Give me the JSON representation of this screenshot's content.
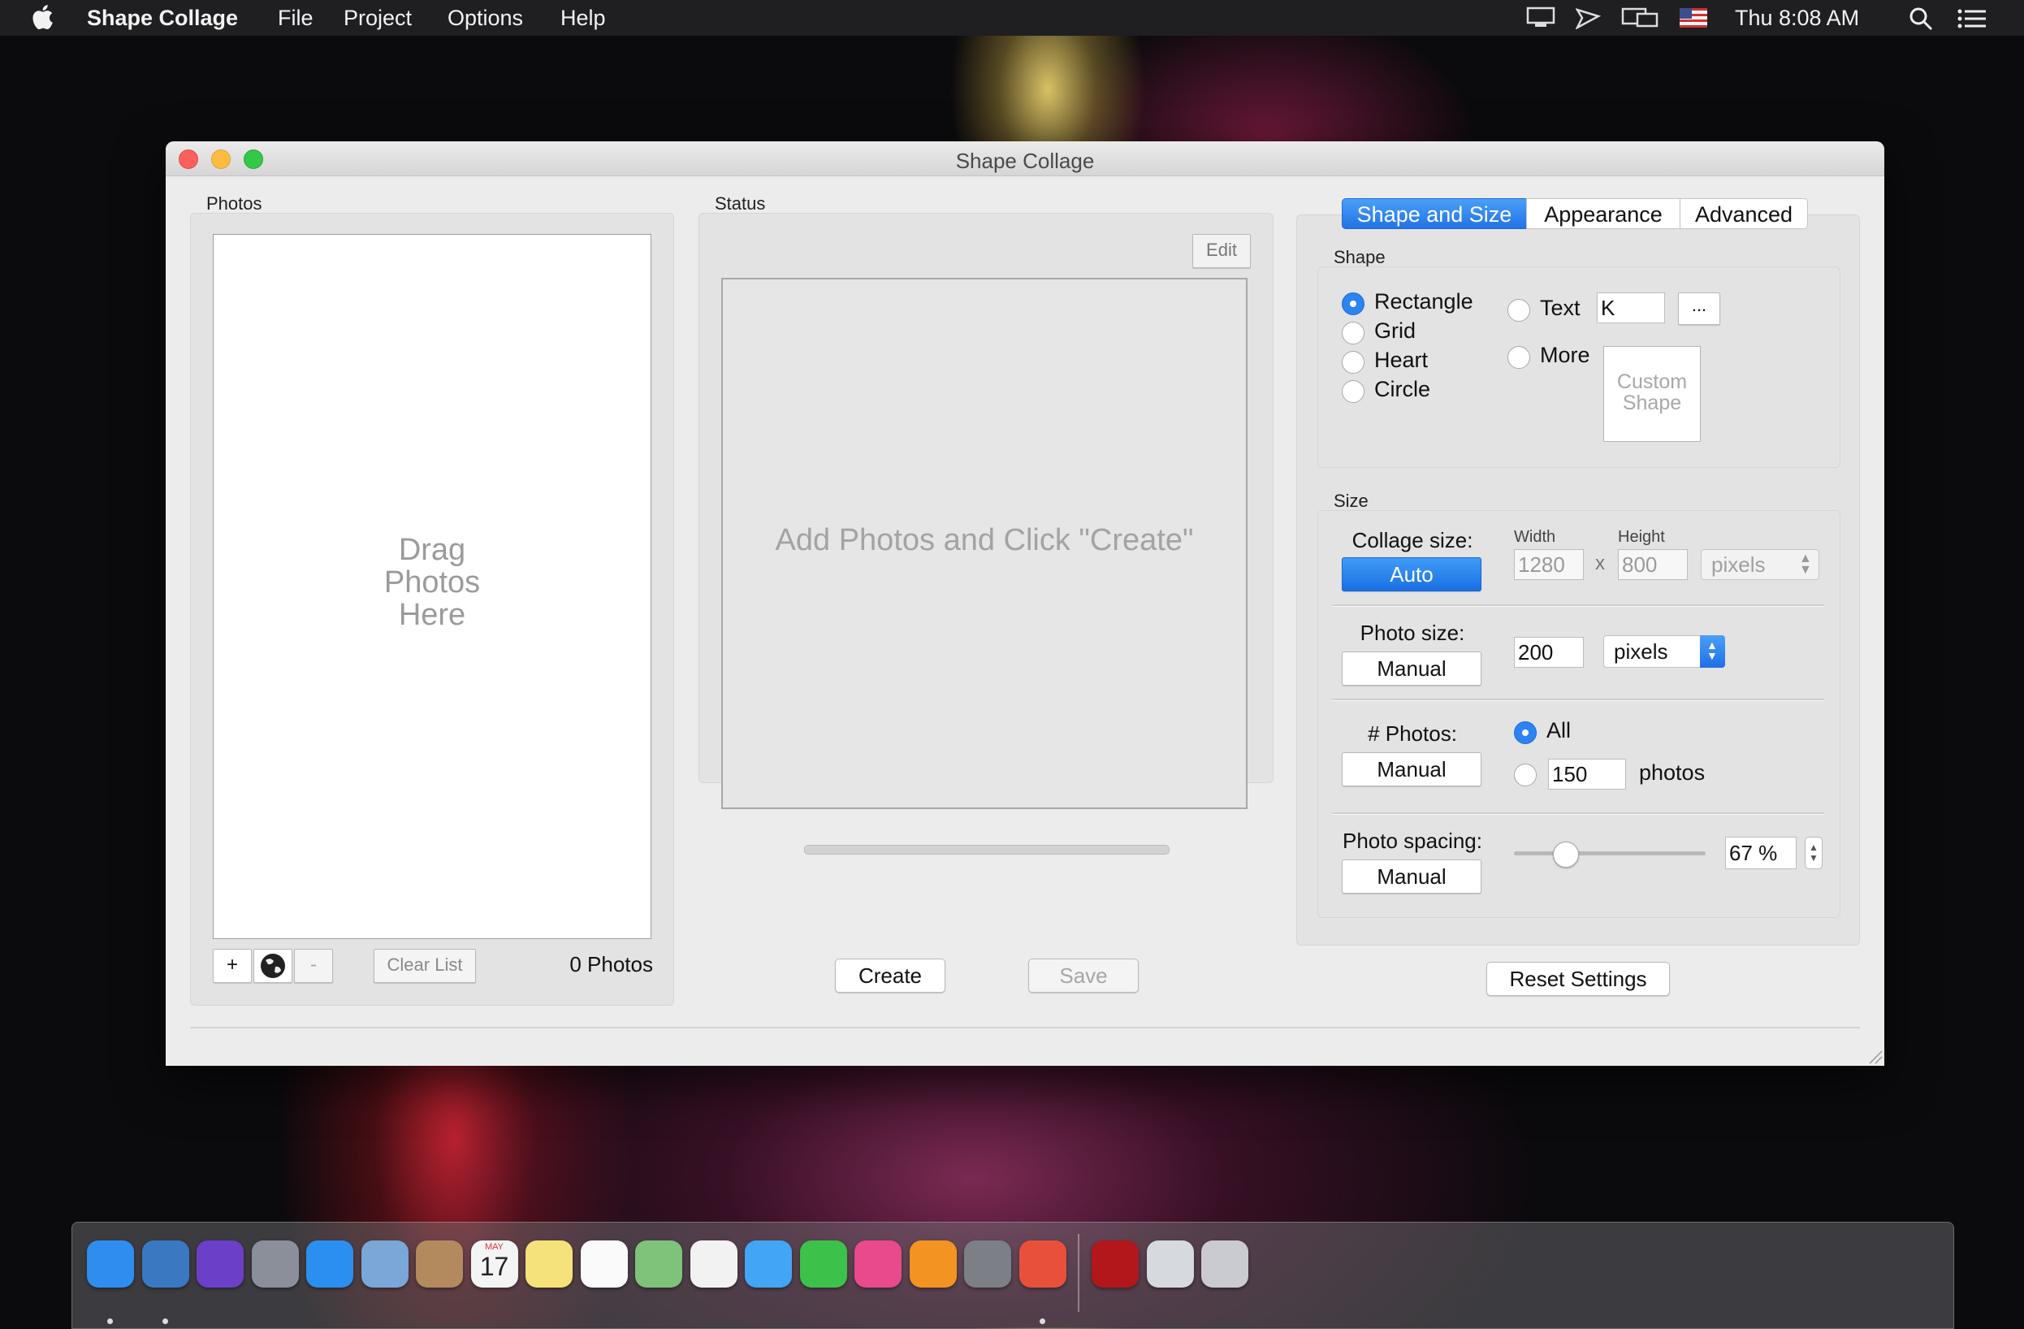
{
  "menubar": {
    "app_name": "Shape Collage",
    "menus": [
      "File",
      "Project",
      "Options",
      "Help"
    ],
    "clock": "Thu 8:08 AM"
  },
  "window": {
    "title": "Shape Collage"
  },
  "photos_panel": {
    "label": "Photos",
    "drop_hint": [
      "Drag",
      "Photos",
      "Here"
    ],
    "add_label": "+",
    "remove_label": "-",
    "clear_label": "Clear List",
    "count_text": "0 Photos"
  },
  "status_panel": {
    "label": "Status",
    "edit_label": "Edit",
    "preview_hint": "Add Photos and Click \"Create\"",
    "progress": 0
  },
  "actions": {
    "create_label": "Create",
    "save_label": "Save",
    "reset_label": "Reset Settings"
  },
  "tabs": [
    {
      "label": "Shape and Size",
      "active": true
    },
    {
      "label": "Appearance",
      "active": false
    },
    {
      "label": "Advanced",
      "active": false
    }
  ],
  "shape": {
    "label": "Shape",
    "options": [
      {
        "label": "Rectangle",
        "selected": true
      },
      {
        "label": "Grid",
        "selected": false
      },
      {
        "label": "Heart",
        "selected": false
      },
      {
        "label": "Circle",
        "selected": false
      },
      {
        "label": "Text",
        "selected": false
      },
      {
        "label": "More",
        "selected": false
      }
    ],
    "text_value": "K",
    "ellipsis_label": "...",
    "custom_shape_label": [
      "Custom",
      "Shape"
    ]
  },
  "size": {
    "label": "Size",
    "collage": {
      "label": "Collage size:",
      "mode": "Auto",
      "width_label": "Width",
      "height_label": "Height",
      "width": "1280",
      "times": "x",
      "height": "800",
      "unit": "pixels"
    },
    "photo": {
      "label": "Photo size:",
      "mode": "Manual",
      "value": "200",
      "unit": "pixels"
    },
    "count": {
      "label": "# Photos:",
      "mode": "Manual",
      "all_label": "All",
      "all_selected": true,
      "value": "150",
      "unit_label": "photos"
    },
    "spacing": {
      "label": "Photo spacing:",
      "mode": "Manual",
      "value_text": "67 %",
      "value": 67
    }
  },
  "colors": {
    "accent": "#2e83f2",
    "window_bg": "#ececec",
    "close": "#fc605c",
    "minimize": "#fdbc40",
    "zoom": "#34c84a"
  },
  "dock": {
    "items": [
      {
        "name": "finder-icon",
        "color": "#2f8df0",
        "running": true
      },
      {
        "name": "network-radar-icon",
        "color": "#3a78c2",
        "running": true
      },
      {
        "name": "siri-icon",
        "color": "#6b3fc8",
        "running": false
      },
      {
        "name": "launchpad-icon",
        "color": "#8a8f99",
        "running": false
      },
      {
        "name": "safari-icon",
        "color": "#2a8ff0",
        "running": false
      },
      {
        "name": "mail-icon",
        "color": "#7aa6d8",
        "running": false
      },
      {
        "name": "contacts-icon",
        "color": "#b28a5e",
        "running": false
      },
      {
        "name": "calendar-icon",
        "color": "#f4f4f4",
        "running": false
      },
      {
        "name": "notes-icon",
        "color": "#f6e27a",
        "running": false
      },
      {
        "name": "reminders-icon",
        "color": "#fafafa",
        "running": false
      },
      {
        "name": "maps-icon",
        "color": "#7fc27a",
        "running": false
      },
      {
        "name": "photos-icon",
        "color": "#f2f2f2",
        "running": false
      },
      {
        "name": "messages-icon",
        "color": "#42a5f5",
        "running": false
      },
      {
        "name": "facetime-icon",
        "color": "#3cc24a",
        "running": false
      },
      {
        "name": "itunes-icon",
        "color": "#e84a8c",
        "running": false
      },
      {
        "name": "ibooks-icon",
        "color": "#f29322",
        "running": false
      },
      {
        "name": "system-preferences-icon",
        "color": "#7d7f86",
        "running": false
      },
      {
        "name": "shape-collage-icon",
        "color": "#e8503c",
        "running": true
      },
      {
        "name": "acrobat-icon",
        "color": "#b3171b",
        "running": false
      },
      {
        "name": "preview-icon",
        "color": "#d6d9de",
        "running": false
      },
      {
        "name": "trash-icon",
        "color": "#c9cbd0",
        "running": false
      }
    ],
    "calendar_month": "MAY",
    "calendar_day": "17"
  }
}
